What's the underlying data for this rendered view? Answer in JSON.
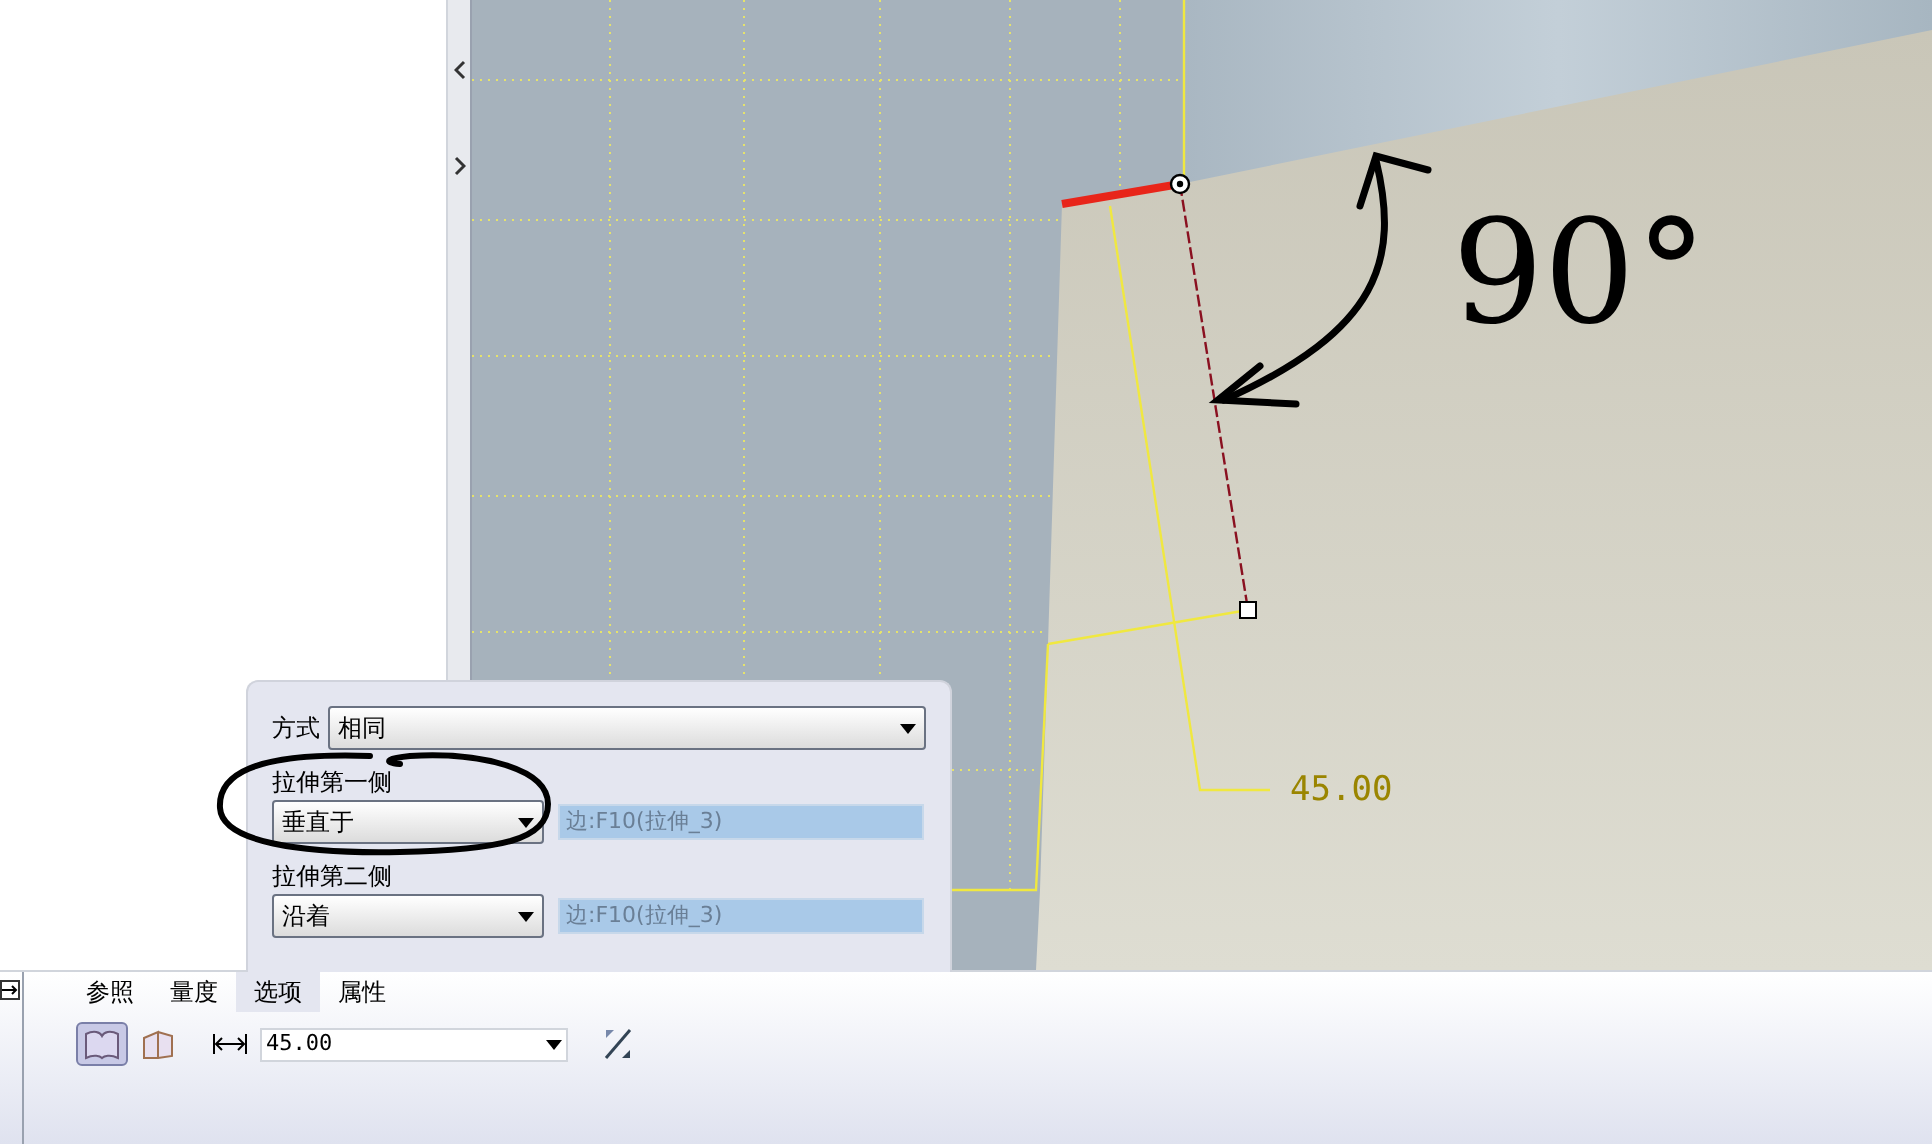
{
  "viewport": {
    "dimension": "45.00",
    "annotation": "90°"
  },
  "options_panel": {
    "method_label": "方式",
    "method_value": "相同",
    "sides": [
      {
        "label": "拉伸第一侧",
        "value": "垂直于",
        "reference": "边:F10(拉伸_3)"
      },
      {
        "label": "拉伸第二侧",
        "value": "沿着",
        "reference": "边:F10(拉伸_3)"
      }
    ]
  },
  "tabs": [
    {
      "label": "参照",
      "selected": false
    },
    {
      "label": "量度",
      "selected": false
    },
    {
      "label": "选项",
      "selected": true
    },
    {
      "label": "属性",
      "selected": false
    }
  ],
  "dashboard": {
    "direction_buttons": [
      {
        "selected": true
      },
      {
        "selected": false
      }
    ],
    "depth_value": "45.00"
  }
}
